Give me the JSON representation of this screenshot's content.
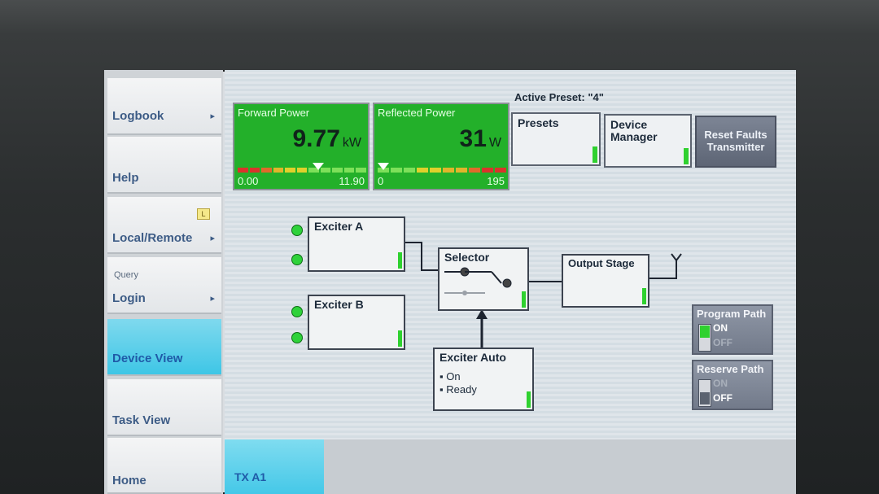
{
  "sidebar": {
    "items": [
      {
        "label": "Logbook",
        "arrow": "▸"
      },
      {
        "label": "Help"
      },
      {
        "label": "Local/Remote",
        "arrow": "▸",
        "badge": "L"
      },
      {
        "label": "Login",
        "arrow": "▸",
        "sublabel": "Query"
      },
      {
        "label": "Device View",
        "active": true
      },
      {
        "label": "Task View"
      },
      {
        "label": "Home"
      }
    ]
  },
  "header": {
    "active_preset": "Active Preset: \"4\""
  },
  "forward_power": {
    "title": "Forward Power",
    "value": "9.77",
    "unit": "kW",
    "min": "0.00",
    "max": "11.90"
  },
  "reflected_power": {
    "title": "Reflected Power",
    "value": "31",
    "unit": "W",
    "min": "0",
    "max": "195"
  },
  "buttons": {
    "presets": "Presets",
    "device_manager_1": "Device",
    "device_manager_2": "Manager",
    "reset_faults_1": "Reset Faults",
    "reset_faults_2": "Transmitter"
  },
  "diagram": {
    "exciter_a": "Exciter A",
    "exciter_b": "Exciter B",
    "selector": "Selector",
    "output_stage": "Output Stage",
    "exciter_auto": {
      "title": "Exciter Auto",
      "status1": "On",
      "status2": "Ready"
    }
  },
  "program_path": {
    "title": "Program Path",
    "on": "ON",
    "off": "OFF",
    "state": "ON"
  },
  "reserve_path": {
    "title": "Reserve Path",
    "on": "ON",
    "off": "OFF",
    "state": "OFF"
  },
  "bottom_tab": {
    "label": "TX A1"
  },
  "colors": {
    "green": "#23b02a",
    "accent": "#45c8e8",
    "led": "#2ed23a"
  }
}
